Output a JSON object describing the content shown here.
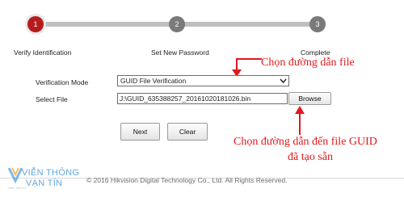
{
  "stepper": {
    "steps": [
      {
        "number": "1",
        "label": "Verify Identification",
        "state": "active"
      },
      {
        "number": "2",
        "label": "Set New Password",
        "state": "inactive"
      },
      {
        "number": "3",
        "label": "Complete",
        "state": "inactive"
      }
    ],
    "active_color": "#b71c1c",
    "inactive_color": "#7a7a7a"
  },
  "form": {
    "verification_mode_label": "Verification Mode",
    "verification_mode_value": "GUID File Verification",
    "select_file_label": "Select File",
    "file_path_value": "J:\\GUID_635388257_20161020181026.bin",
    "browse_label": "Browse"
  },
  "actions": {
    "next_label": "Next",
    "clear_label": "Clear"
  },
  "annotations": {
    "path_note": "Chọn đường dẫn file",
    "guid_note_line1": "Chọn đường dẫn đến file GUID",
    "guid_note_line2": "đã tạo sẵn",
    "color": "#e0191c"
  },
  "footer": {
    "copyright": "© 2016 Hikvision Digital Technology Co., Ltd. All Rights Reserved.",
    "watermark_top": "VIỄN THÔNG",
    "watermark_bottom": "VẠN TÍN",
    "watermark_small": "VAN TIN CO"
  }
}
